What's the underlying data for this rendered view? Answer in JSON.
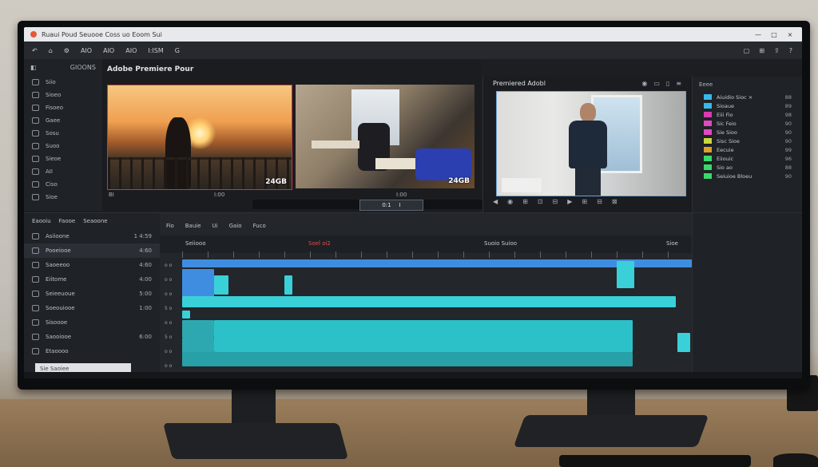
{
  "titlebar": {
    "title": "Ruaui Poud Seuooe Coss uo   Eoom   Sui",
    "controls": [
      "—",
      "□",
      "×"
    ]
  },
  "menubar": {
    "items": [
      "AIO",
      "AIO",
      "AIO",
      "I:ISM",
      "G"
    ]
  },
  "left_panel": {
    "header": "GIOONS",
    "items": [
      "Siio",
      "Sioeo",
      "Fisoeo",
      "Gaee",
      "Sosu",
      "Suoo",
      "Sieoe",
      "AII",
      "Ciso",
      "Sioe"
    ]
  },
  "source_monitor": {
    "title": "Adobe Premiere Pour",
    "clip1_badge": "24GB",
    "clip2_badge": "24GB",
    "labels": [
      "BI",
      "I:00",
      "I:00"
    ],
    "ctrl": [
      "0:1",
      "I"
    ]
  },
  "program_monitor": {
    "title": "Premiered Adobl",
    "icons": [
      "◉",
      "▭",
      "▯",
      "≡"
    ],
    "controls": [
      "◀",
      "◉",
      "⊞",
      "⊡",
      "⊟",
      "▶",
      "⊞",
      "⊟",
      "⊠"
    ]
  },
  "effects_panel": {
    "header": "Eeee",
    "items": [
      {
        "label": "Aiuidio  Sioc  ×",
        "color": "#39b8e8",
        "num": "88"
      },
      {
        "label": "Sioaue",
        "color": "#39b8e8",
        "num": "89"
      },
      {
        "label": "Eiii  Fio",
        "color": "#d93bb0",
        "num": "98"
      },
      {
        "label": "Sic  Feio",
        "color": "#e04ac0",
        "num": "90"
      },
      {
        "label": "Sie  Sioo",
        "color": "#e04ac0",
        "num": "90"
      },
      {
        "label": "Sisc  Sioe",
        "color": "#c9d93b",
        "num": "90"
      },
      {
        "label": "Eecuie",
        "color": "#e0a02c",
        "num": "99"
      },
      {
        "label": "Eiiouic",
        "color": "#3bd96a",
        "num": "96"
      },
      {
        "label": "Sio  ao",
        "color": "#3bd96a",
        "num": "88"
      },
      {
        "label": "Seiuioe  Bloeu",
        "color": "#3bd96a",
        "num": "90"
      }
    ]
  },
  "project_panel": {
    "tabs": [
      "Eaooiu",
      "Faooe",
      "Seaoone"
    ],
    "rows": [
      {
        "label": "Asiioone",
        "val": "1   4:59"
      },
      {
        "label": "Pooeiooe",
        "val": "4:60"
      },
      {
        "label": "Saoeeoo",
        "val": "4:60"
      },
      {
        "label": "Eiitome",
        "val": "4:00"
      },
      {
        "label": "Seieeuoue",
        "val": "5:00"
      },
      {
        "label": "Soeouiooe",
        "val": "1:00"
      },
      {
        "label": "Sisoooe",
        "val": ""
      },
      {
        "label": "Saooiooe",
        "val": "6:00"
      },
      {
        "label": "Etaoooo",
        "val": ""
      }
    ],
    "search_placeholder": "Sie  Saoiee"
  },
  "timeline": {
    "tabs": [
      "Fio",
      "Bauie",
      "Ui",
      "Gaio",
      "Fuco"
    ],
    "seq_name": "Seiiooo",
    "marker": "Soeî  oi2",
    "center": "Suoio  Suioo",
    "right": "Sioe",
    "track_labels": [
      "o  o",
      "o  o",
      "o  o",
      "5  o",
      "o  o",
      "5  o",
      "o  o",
      "o  o"
    ]
  },
  "colors": {
    "accent_clip": "#3ad0d8",
    "video_clip": "#3f8de0",
    "audio_clip": "#2cc1c8"
  }
}
